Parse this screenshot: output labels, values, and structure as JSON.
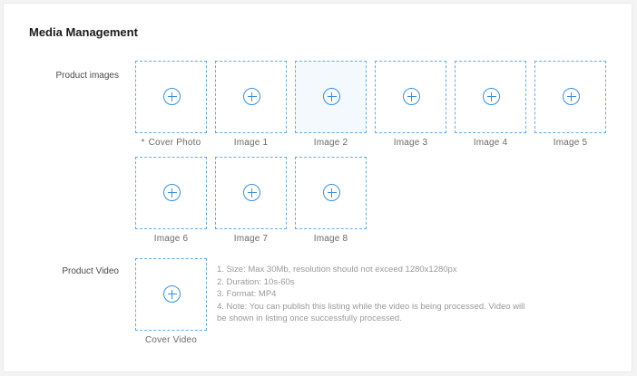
{
  "section": {
    "title": "Media Management"
  },
  "product_images": {
    "label": "Product images",
    "required_mark": "*",
    "slots": [
      {
        "caption": "Cover Photo",
        "required": true
      },
      {
        "caption": "Image  1"
      },
      {
        "caption": "Image  2",
        "hovered": true
      },
      {
        "caption": "Image  3"
      },
      {
        "caption": "Image  4"
      },
      {
        "caption": "Image  5"
      },
      {
        "caption": "Image  6"
      },
      {
        "caption": "Image  7"
      },
      {
        "caption": "Image  8"
      }
    ]
  },
  "product_video": {
    "label": "Product Video",
    "slot": {
      "caption": "Cover Video"
    },
    "notes": [
      "1. Size: Max 30Mb, resolution should not exceed 1280x1280px",
      "2. Duration: 10s-60s",
      "3. Format: MP4",
      "4. Note: You can publish this listing while the video is being processed. Video will be shown in listing once successfully processed."
    ]
  },
  "colors": {
    "accent": "#3a8fd9",
    "dashed_border": "#6aa8e0",
    "hover_bg": "#f4f9fe"
  },
  "icons": {
    "upload": "plus-circle-icon"
  }
}
